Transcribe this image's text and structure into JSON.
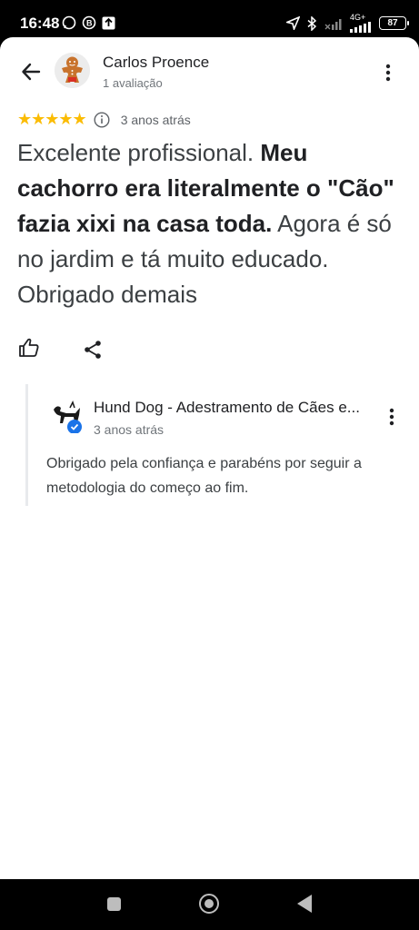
{
  "status_bar": {
    "time": "16:48",
    "network": "4G+",
    "battery": "87"
  },
  "review": {
    "author_name": "Carlos Proence",
    "author_meta": "1 avaliação",
    "stars": "★★★★★",
    "rating": 5,
    "date": "3 anos atrás",
    "text_part1": "Excelente profissional. ",
    "text_bold": "Meu cachorro era literalmente o \"Cão\" fazia xixi na casa toda.",
    "text_part2": " Agora é só no jardim e tá muito educado. Obrigado demais"
  },
  "owner_response": {
    "name": "Hund Dog - Adestramento de Cães e...",
    "date": "3 anos atrás",
    "text": "Obrigado pela confiança e parabéns por seguir a metodologia do começo ao fim."
  },
  "colors": {
    "star": "#fbbc04",
    "verified": "#1a73e8",
    "text": "#202124",
    "muted": "#70757a"
  }
}
